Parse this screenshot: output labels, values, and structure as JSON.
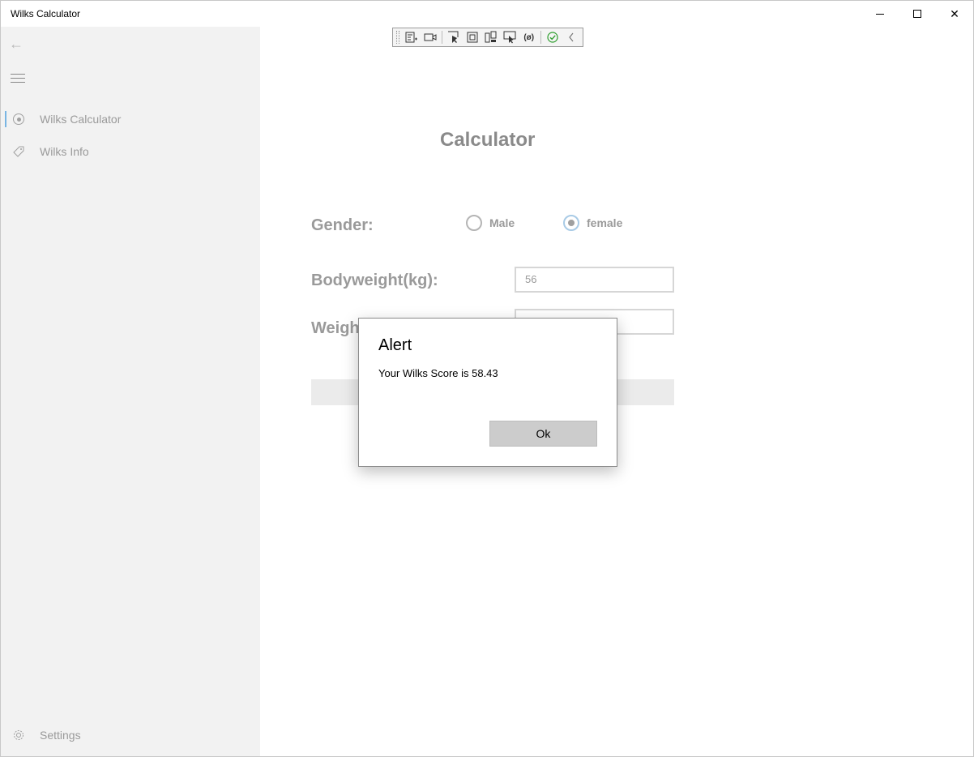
{
  "window": {
    "title": "Wilks Calculator"
  },
  "sidebar": {
    "items": [
      {
        "label": "Wilks Calculator",
        "icon": "radio-icon",
        "selected": true
      },
      {
        "label": "Wilks Info",
        "icon": "tag-icon",
        "selected": false
      }
    ],
    "settings_label": "Settings"
  },
  "main": {
    "title": "Calculator",
    "gender_label": "Gender:",
    "gender_options": [
      {
        "label": "Male",
        "checked": false
      },
      {
        "label": "female",
        "checked": true
      }
    ],
    "bodyweight_label": "Bodyweight(kg):",
    "bodyweight_value": "56",
    "weight_label": "Weigh"
  },
  "dialog": {
    "title": "Alert",
    "message": "Your Wilks Score is 58.43",
    "ok_label": "Ok"
  },
  "colors": {
    "accent": "#0078d4",
    "sidebar_bg": "#f2f2f2",
    "dialog_button": "#cccccc"
  }
}
